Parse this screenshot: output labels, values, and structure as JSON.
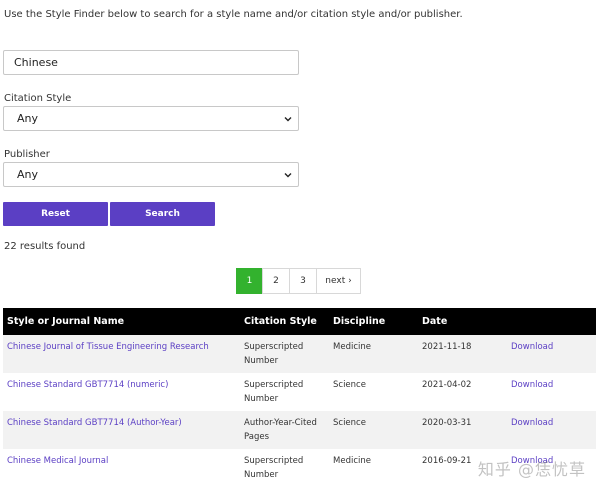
{
  "intro_text": "Use the Style Finder below to search for a style name and/or citation style and/or publisher.",
  "search": {
    "value": "Chinese"
  },
  "citation_style": {
    "label": "Citation Style",
    "selected": "Any"
  },
  "publisher": {
    "label": "Publisher",
    "selected": "Any"
  },
  "buttons": {
    "reset": "Reset",
    "search": "Search"
  },
  "results_count": "22 results found",
  "pagination": {
    "pages": [
      "1",
      "2",
      "3"
    ],
    "next": "next ›",
    "active": "1"
  },
  "table": {
    "headers": [
      "Style or Journal Name",
      "Citation Style",
      "Discipline",
      "Date"
    ],
    "rows": [
      {
        "name": "Chinese Journal of Tissue Engineering Research",
        "citation": "Superscripted Number",
        "discipline": "Medicine",
        "date": "2021-11-18",
        "action": "Download"
      },
      {
        "name": "Chinese Standard GBT7714 (numeric)",
        "citation": "Superscripted Number",
        "discipline": "Science",
        "date": "2021-04-02",
        "action": "Download"
      },
      {
        "name": "Chinese Standard GBT7714 (Author-Year)",
        "citation": "Author-Year-Cited Pages",
        "discipline": "Science",
        "date": "2020-03-31",
        "action": "Download"
      },
      {
        "name": "Chinese Medical Journal",
        "citation": "Superscripted Number",
        "discipline": "Medicine",
        "date": "2016-09-21",
        "action": "Download"
      }
    ]
  },
  "watermark": "知乎 @恁忧草",
  "colors": {
    "accent": "#5b3fc4",
    "active_page": "#33b22e",
    "header_bg": "#000000"
  }
}
